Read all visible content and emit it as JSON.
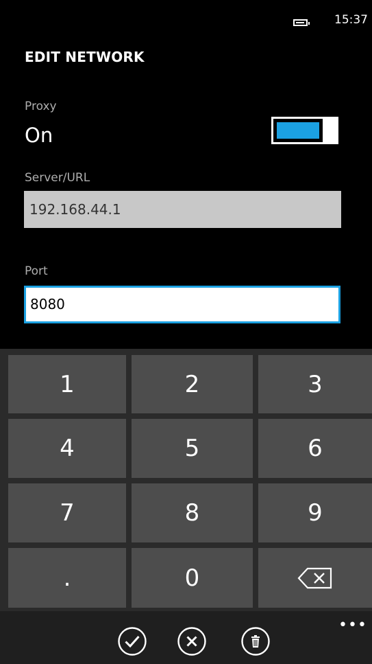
{
  "status_bar": {
    "time": "15:37",
    "battery_icon": "battery-icon"
  },
  "header": {
    "title": "EDIT NETWORK"
  },
  "proxy": {
    "label": "Proxy",
    "value": "On",
    "toggle_state": "on",
    "accent_color": "#1ba1e2"
  },
  "server": {
    "label": "Server/URL",
    "value": "192.168.44.1"
  },
  "port": {
    "label": "Port",
    "value": "8080"
  },
  "keypad": {
    "keys": [
      "1",
      "2",
      "3",
      "4",
      "5",
      "6",
      "7",
      "8",
      "9",
      ".",
      "0"
    ],
    "backspace_icon": "backspace-icon"
  },
  "app_bar": {
    "buttons": [
      {
        "icon": "check-icon",
        "action": "save"
      },
      {
        "icon": "close-icon",
        "action": "cancel"
      },
      {
        "icon": "trash-icon",
        "action": "delete"
      }
    ],
    "more_icon": "more-icon"
  }
}
